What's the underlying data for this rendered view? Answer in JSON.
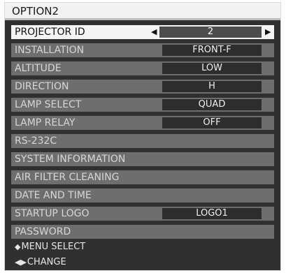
{
  "title": "OPTION2",
  "items": [
    {
      "label": "PROJECTOR ID",
      "value": "2",
      "selected": true
    },
    {
      "label": "INSTALLATION",
      "value": "FRONT-F"
    },
    {
      "label": "ALTITUDE",
      "value": "LOW"
    },
    {
      "label": "DIRECTION",
      "value": "H"
    },
    {
      "label": "LAMP SELECT",
      "value": "QUAD"
    },
    {
      "label": "LAMP RELAY",
      "value": "OFF"
    },
    {
      "label": "RS-232C"
    },
    {
      "label": "SYSTEM INFORMATION"
    },
    {
      "label": "AIR FILTER CLEANING"
    },
    {
      "label": "DATE AND TIME"
    },
    {
      "label": "STARTUP LOGO",
      "value": "LOGO1"
    },
    {
      "label": "PASSWORD"
    }
  ],
  "hints": {
    "menu_select_icon": "up-down-arrows-icon",
    "menu_select_label": "MENU SELECT",
    "change_icon": "left-right-arrows-icon",
    "change_label": "CHANGE"
  },
  "arrows": {
    "left": "◀",
    "right": "▶",
    "updown": "◆",
    "leftright": "◀▶"
  }
}
